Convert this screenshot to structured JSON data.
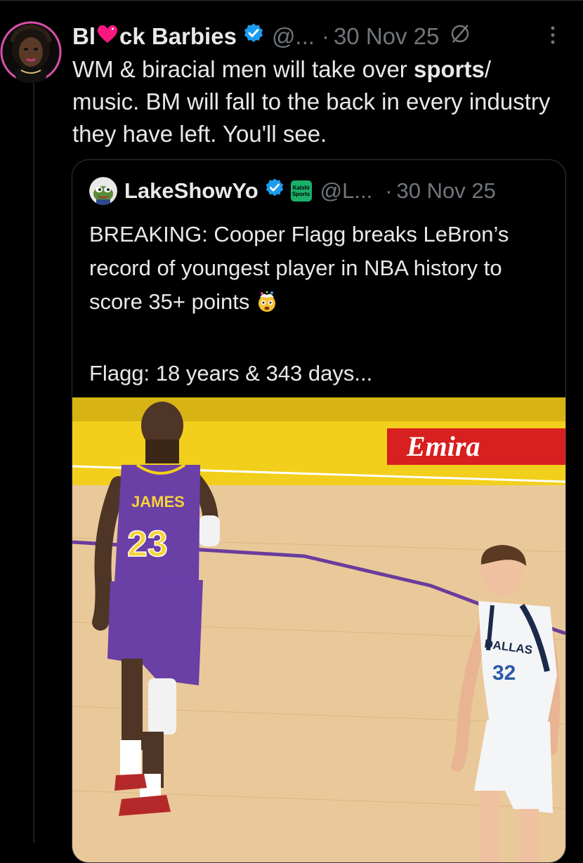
{
  "tweet": {
    "author_name_prefix": "Bl",
    "author_name_suffix": "ck Barbies",
    "author_handle": "@...",
    "separator": "·",
    "timestamp": "30 Nov 25",
    "text_part1": "WM & biracial men will take over ",
    "text_bold": "sports",
    "text_part2": "/ music. BM will fall to the back in every industry they have left. You'll see.",
    "icons": [
      "heart-emoji-icon",
      "verified-badge-icon",
      "muted-icon",
      "more-options-icon"
    ]
  },
  "quote": {
    "author_name": "LakeShowYo",
    "author_handle": "@L...",
    "separator": "·",
    "timestamp": "30 Nov 25",
    "badge_line1": "Kalshi",
    "badge_line2": "Sports",
    "text_line1": "BREAKING: Cooper Flagg breaks LeBron’s record of youngest player in NBA history to score 35+ points",
    "text_line2": "Flagg:  18 years & 343 days...",
    "photo": {
      "banner_text": "Emira",
      "player1_name": "JAMES",
      "player1_number": "23",
      "player2_team": "DALLAS",
      "player2_number": "32"
    }
  },
  "colors": {
    "background": "#000000",
    "text": "#e7e9ea",
    "secondary": "#71767b",
    "verified": "#1d9bf0",
    "heart": "#f91880",
    "kalshi": "#1bb06a"
  }
}
